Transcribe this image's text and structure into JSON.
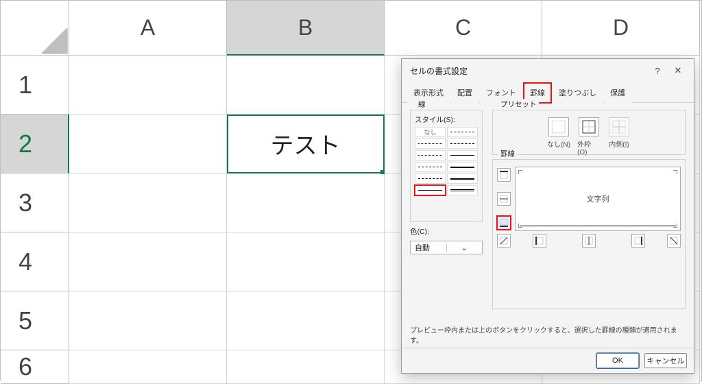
{
  "sheet": {
    "columns": [
      "A",
      "B",
      "C",
      "D"
    ],
    "rows": [
      "1",
      "2",
      "3",
      "4",
      "5",
      "6"
    ],
    "active_col": 1,
    "active_row": 1,
    "cell_b2": "テスト"
  },
  "dialog": {
    "title": "セルの書式設定",
    "help": "?",
    "close": "✕",
    "tabs": {
      "number": "表示形式",
      "align": "配置",
      "font": "フォント",
      "border": "罫線",
      "fill": "塗りつぶし",
      "protect": "保護"
    },
    "line_group": "線",
    "style_label": "スタイル(S):",
    "style_none": "なし",
    "color_label": "色(C):",
    "color_value": "自動",
    "preset_group": "プリセット",
    "preset_none": "なし(N)",
    "preset_outline": "外枠(O)",
    "preset_inside": "内側(I)",
    "border_group": "罫線",
    "preview_text": "文字列",
    "hint": "プレビュー枠内または上のボタンをクリックすると、選択した罫線の種類が適用されます。",
    "ok": "OK",
    "cancel": "キャンセル"
  }
}
